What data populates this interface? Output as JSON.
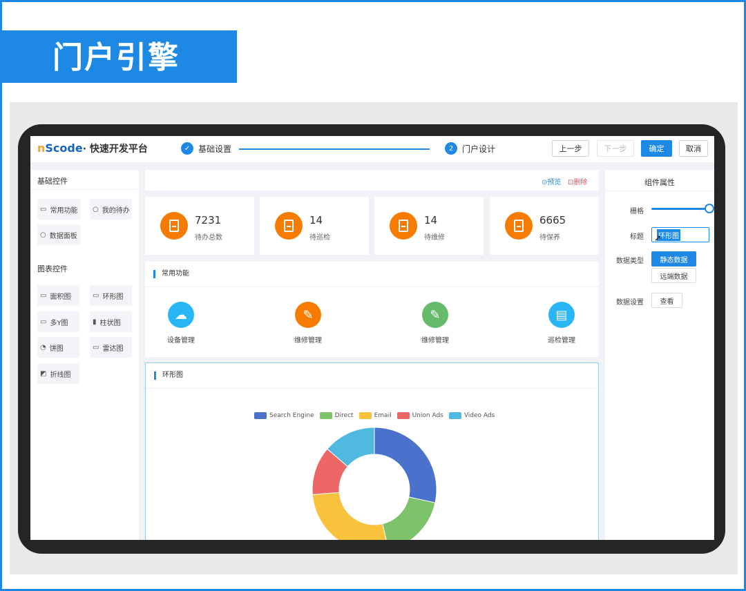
{
  "banner": {
    "title": "门户引擎"
  },
  "header": {
    "logo_n": "n",
    "logo_main": "Scode",
    "logo_sub": "· 快速开发平台",
    "steps": [
      {
        "label": "基础设置",
        "index": "✓"
      },
      {
        "label": "门户设计",
        "index": "2"
      }
    ],
    "buttons": {
      "prev": "上一步",
      "next": "下一步",
      "confirm": "确定",
      "cancel": "取消"
    }
  },
  "left_panel": {
    "basic_title": "基础控件",
    "basic_items": [
      {
        "label": "常用功能",
        "icon": "monitor-icon"
      },
      {
        "label": "我的待办",
        "icon": "circle-icon"
      },
      {
        "label": "数据面板",
        "icon": "circle-icon"
      }
    ],
    "chart_title": "图表控件",
    "chart_items": [
      {
        "label": "面积图",
        "icon": "monitor-icon"
      },
      {
        "label": "环形图",
        "icon": "monitor-icon"
      },
      {
        "label": "多Y图",
        "icon": "monitor-icon"
      },
      {
        "label": "柱状图",
        "icon": "bar-icon"
      },
      {
        "label": "饼图",
        "icon": "pie-icon"
      },
      {
        "label": "雷达图",
        "icon": "monitor-icon"
      },
      {
        "label": "折线图",
        "icon": "line-icon"
      }
    ]
  },
  "toolbar": {
    "preview": "⊙预览",
    "delete": "⊡删除"
  },
  "stats": [
    {
      "value": "7231",
      "label": "待办总数"
    },
    {
      "value": "14",
      "label": "待巡检"
    },
    {
      "value": "14",
      "label": "待维修"
    },
    {
      "value": "6665",
      "label": "待保养"
    }
  ],
  "functions": {
    "title": "常用功能",
    "items": [
      {
        "label": "设备管理",
        "icon": "cloud-icon",
        "color": "#29b6f6"
      },
      {
        "label": "维修管理",
        "icon": "wrench-icon",
        "color": "#f57c00"
      },
      {
        "label": "维修管理",
        "icon": "wrench-icon",
        "color": "#66bb6a"
      },
      {
        "label": "巡检管理",
        "icon": "book-icon",
        "color": "#29b6f6"
      }
    ]
  },
  "donut_panel": {
    "title": "环形图"
  },
  "chart_data": {
    "type": "pie",
    "donut": true,
    "categories": [
      "Search Engine",
      "Direct",
      "Email",
      "Union Ads",
      "Video Ads"
    ],
    "values": [
      27,
      17,
      26,
      12,
      13
    ],
    "colors": [
      "#4a72cc",
      "#7cc36a",
      "#f9c23c",
      "#ee6666",
      "#4fb9e0"
    ],
    "legend_position": "top"
  },
  "right_panel": {
    "title": "组件属性",
    "grid_label": "栅格",
    "grid_value": 1.0,
    "title_label": "标题",
    "title_value": "环形图",
    "data_type_label": "数据类型",
    "data_type_static": "静态数据",
    "data_type_remote": "远端数据",
    "data_setting_label": "数据设置",
    "view_button": "查看"
  }
}
